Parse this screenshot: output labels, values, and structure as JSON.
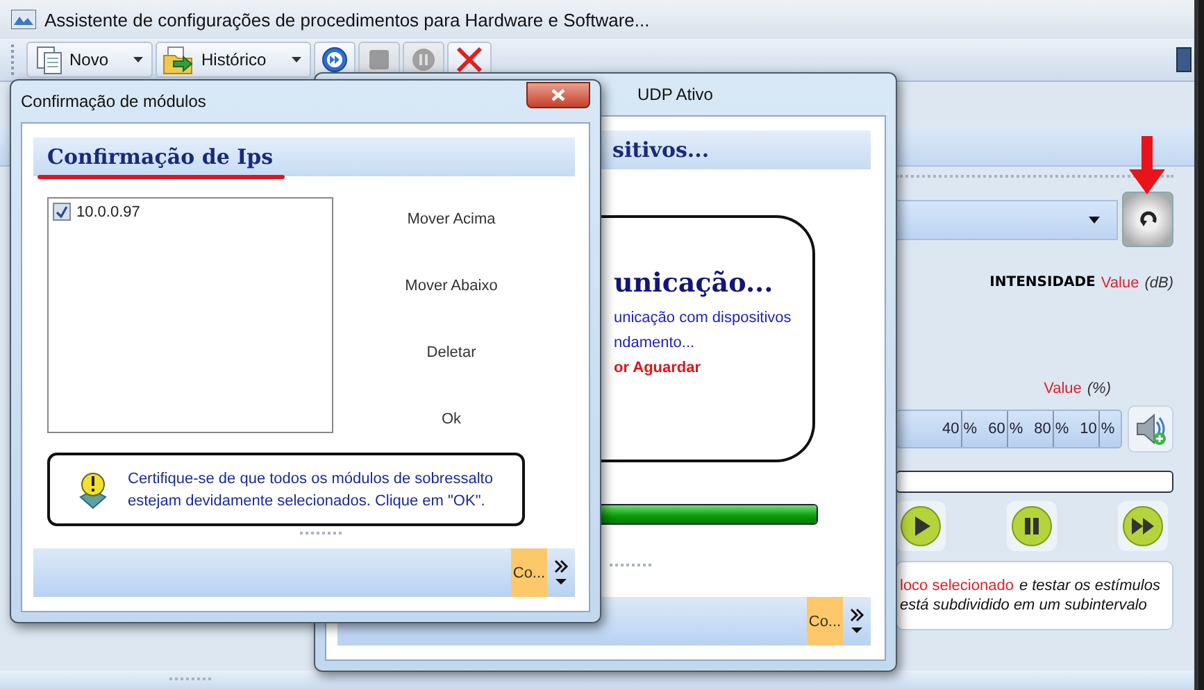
{
  "main_window": {
    "title": "Assistente de configurações de procedimentos para Hardware e Software...",
    "toolbar": [
      {
        "kind": "menu",
        "label": "Novo",
        "disabled": false
      },
      {
        "kind": "menu",
        "label": "Histórico",
        "disabled": false
      },
      {
        "kind": "icon",
        "disabled": false
      },
      {
        "kind": "icon",
        "disabled": true
      },
      {
        "kind": "icon",
        "disabled": true
      },
      {
        "kind": "icon",
        "disabled": false
      }
    ],
    "intensity": {
      "label": "INTENSIDADE",
      "value": "Value",
      "unit": "(dB)"
    },
    "percent": {
      "value": "Value",
      "unit": "(%)"
    },
    "scale_ticks": [
      {
        "number": "40",
        "unit": "%"
      },
      {
        "number": "60",
        "unit": "%"
      },
      {
        "number": "80",
        "unit": "%"
      },
      {
        "number": "10",
        "unit": "%"
      }
    ],
    "info_lines": [
      [
        {
          "kind": "highlight",
          "text": "loco selecionado"
        },
        {
          "kind": "italic",
          "text": "e testar os estímulos"
        }
      ],
      [
        {
          "kind": "italic",
          "text": "está subdividido em um subintervalo"
        }
      ]
    ]
  },
  "udp_dialog": {
    "title": "UDP Ativo",
    "header": "sitivos...",
    "message": [
      {
        "kind": "heading",
        "text": "unicação..."
      },
      {
        "kind": "info",
        "text": "unicação com dispositivos"
      },
      {
        "kind": "info",
        "text": "ndamento..."
      },
      {
        "kind": "warning",
        "text": "or Aguardar"
      }
    ],
    "progress": {
      "level": 1
    },
    "footer_button": "Co..."
  },
  "confirm_dialog": {
    "title": "Confirmação de módulos",
    "header": "Confirmação de Ips",
    "items": [
      {
        "label": "10.0.0.97",
        "checked": true
      }
    ],
    "buttons": [
      "Mover Acima",
      "Mover Abaixo",
      "Deletar",
      "Ok"
    ],
    "note": "Certifique-se de que todos os módulos de sobressalto estejam devidamente selecionados. Clique em \"OK\".",
    "footer_button": "Co..."
  }
}
